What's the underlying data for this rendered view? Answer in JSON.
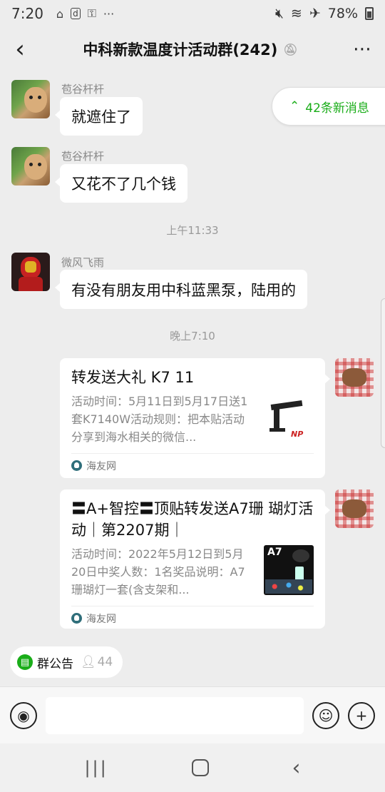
{
  "status_bar": {
    "time": "7:20",
    "battery": "78%",
    "left_icons": [
      "gallery-icon",
      "d-app-icon",
      "vpn-icon",
      "more-dots-icon"
    ],
    "right_icons": [
      "mute-icon",
      "wifi-icon",
      "airplane-icon",
      "battery-icon"
    ]
  },
  "header": {
    "title": "中科新款温度计活动群(242)",
    "back_icon": "chevron-left-icon",
    "mute_icon": "bell-off-icon",
    "more_label": "⋯"
  },
  "new_messages_pill": {
    "label": "42条新消息",
    "icon": "double-chevron-up-icon"
  },
  "messages": [
    {
      "sender": "苞谷杆杆",
      "text": "就遮住了",
      "avatar": "cat-avatar"
    },
    {
      "sender": "苞谷杆杆",
      "text": "又花不了几个钱",
      "avatar": "cat-avatar"
    },
    {
      "timestamp": "上午11:33"
    },
    {
      "sender": "微风飞雨",
      "text": "有没有朋友用中科蓝黑泵，陆用的",
      "avatar": "ironman-avatar"
    },
    {
      "timestamp": "晚上7:10"
    }
  ],
  "cards": [
    {
      "title": "转发送大礼 K7 11",
      "desc": "活动时间：5月11日到5月17日送1套K7140W活动规则：把本贴活动分享到海水相关的微信...",
      "source": "海友网",
      "thumb_logo": "NP"
    },
    {
      "title": "〓A+智控〓顶贴转发送A7珊 瑚灯活动｜第2207期｜",
      "desc": "活动时间：2022年5月12日到5月20日中奖人数：1名奖品说明：A7珊瑚灯一套(含支架和...",
      "source": "海友网",
      "thumb_label": "A7"
    }
  ],
  "bottom": {
    "notice_label": "群公告",
    "member_count": "44",
    "input_value": ""
  }
}
